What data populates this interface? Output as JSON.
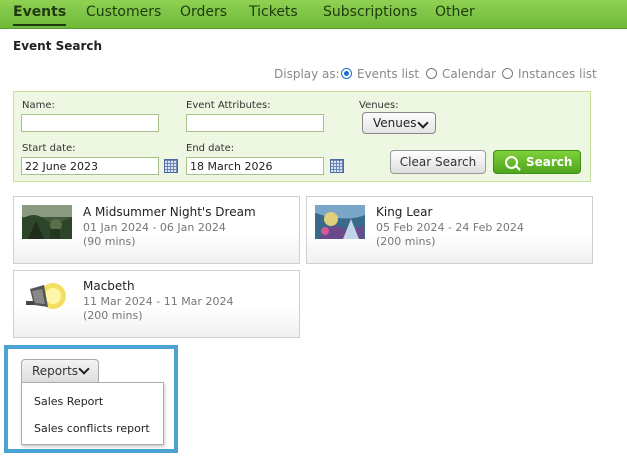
{
  "nav": {
    "tabs": [
      {
        "label": "Events",
        "active": true
      },
      {
        "label": "Customers",
        "active": false
      },
      {
        "label": "Orders",
        "active": false
      },
      {
        "label": "Tickets",
        "active": false
      },
      {
        "label": "Subscriptions",
        "active": false
      },
      {
        "label": "Other",
        "active": false
      }
    ]
  },
  "page_title": "Event Search",
  "display": {
    "label": "Display as:",
    "options": [
      {
        "label": "Events list",
        "selected": true
      },
      {
        "label": "Calendar",
        "selected": false
      },
      {
        "label": "Instances list",
        "selected": false
      }
    ]
  },
  "search": {
    "name_label": "Name:",
    "name_value": "",
    "attributes_label": "Event Attributes:",
    "attributes_value": "",
    "venues_label": "Venues:",
    "venues_value": "Venues",
    "start_label": "Start date:",
    "start_value": "22 June 2023",
    "end_label": "End date:",
    "end_value": "18 March 2026",
    "clear_label": "Clear Search",
    "search_label": "Search"
  },
  "events": [
    {
      "title": "A Midsummer Night's Dream",
      "dates": "01 Jan 2024 -  06 Jan 2024",
      "duration": "(90 mins)",
      "thumb": "forest-scene"
    },
    {
      "title": "King Lear",
      "dates": "05 Feb 2024 -  24 Feb 2024",
      "duration": "(200 mins)",
      "thumb": "painting-scene"
    },
    {
      "title": "Macbeth",
      "dates": "11 Mar 2024 -  11 Mar 2024",
      "duration": "(200 mins)",
      "thumb": "spotlight-icon"
    }
  ],
  "reports": {
    "label": "Reports",
    "items": [
      "Sales Report",
      "Sales conflicts report"
    ]
  },
  "colors": {
    "nav_green": "#7cc444",
    "search_green": "#5bb528",
    "panel_bg": "#eef7e2",
    "highlight_blue": "#4aa3d2"
  }
}
